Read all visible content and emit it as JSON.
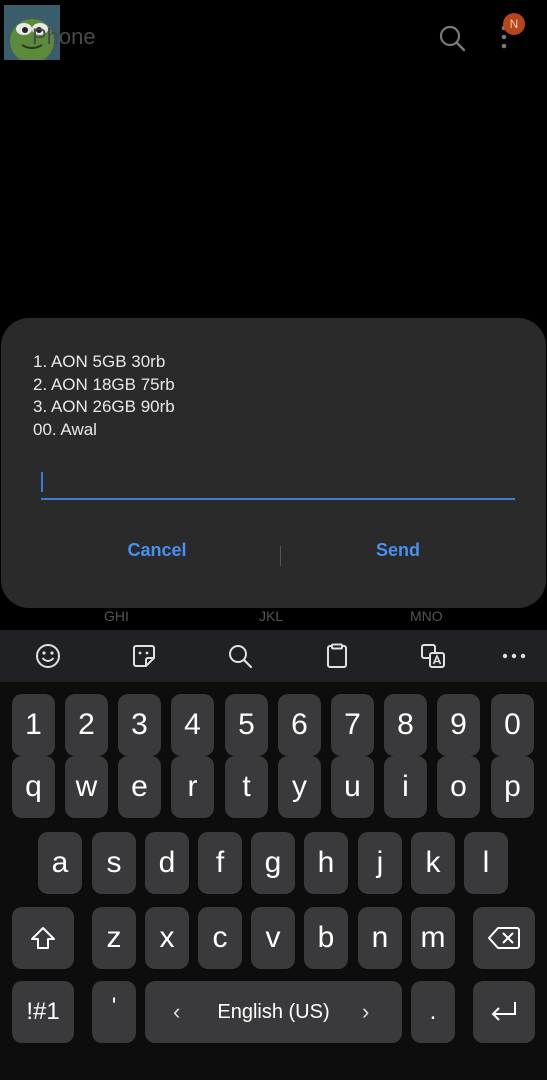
{
  "app": {
    "title": "Phone",
    "badge": "N"
  },
  "dialog": {
    "message_lines": [
      "1. AON 5GB 30rb",
      "2. AON 18GB 75rb",
      "3. AON 26GB 90rb",
      "00. Awal"
    ],
    "input_value": "",
    "cancel_label": "Cancel",
    "send_label": "Send"
  },
  "dialpad_hints": [
    "GHI",
    "JKL",
    "MNO"
  ],
  "keyboard": {
    "toolbar": [
      "emoji-icon",
      "sticker-icon",
      "search-icon",
      "clipboard-icon",
      "translate-icon",
      "more-icon"
    ],
    "numbers": [
      "1",
      "2",
      "3",
      "4",
      "5",
      "6",
      "7",
      "8",
      "9",
      "0"
    ],
    "row1": [
      "q",
      "w",
      "e",
      "r",
      "t",
      "y",
      "u",
      "i",
      "o",
      "p"
    ],
    "row2": [
      "a",
      "s",
      "d",
      "f",
      "g",
      "h",
      "j",
      "k",
      "l"
    ],
    "row3": [
      "z",
      "x",
      "c",
      "v",
      "b",
      "n",
      "m"
    ],
    "symbols_label": "!#1",
    "apostrophe": "'",
    "language": "English (US)",
    "period": ".",
    "shift_icon": "shift-icon",
    "backspace_icon": "backspace-icon",
    "enter_icon": "enter-icon"
  }
}
